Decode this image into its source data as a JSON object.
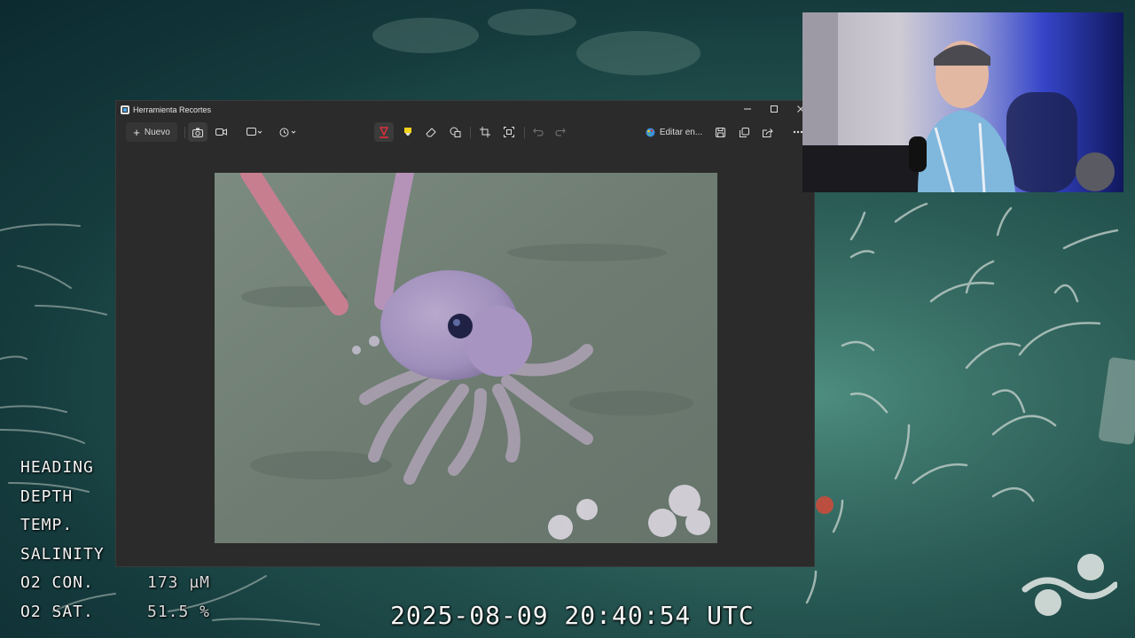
{
  "window": {
    "title": "Herramienta Recortes",
    "new_label": "Nuevo",
    "edit_label": "Editar en...",
    "controls": [
      "minimize-icon",
      "maximize-icon",
      "close-icon"
    ]
  },
  "toolbar": {
    "icons": [
      "camera-icon",
      "video-icon",
      "rectangle-mode-icon",
      "timer-icon",
      "pen-icon",
      "highlighter-icon",
      "eraser-icon",
      "shapes-icon",
      "crop-icon",
      "text-actions-icon",
      "undo-icon",
      "redo-icon",
      "paint-icon",
      "save-icon",
      "copy-icon",
      "share-icon",
      "more-icon"
    ],
    "accent_pen_color": "#e0303a",
    "highlighter_color": "#f2d21b"
  },
  "osd": {
    "rows": [
      {
        "label": "HEADING",
        "value": ""
      },
      {
        "label": "DEPTH",
        "value": ""
      },
      {
        "label": "TEMP.",
        "value": ""
      },
      {
        "label": "SALINITY",
        "value": ""
      },
      {
        "label": "O2 CON.",
        "value": "173 µM"
      },
      {
        "label": "O2 SAT.",
        "value": "51.5 %"
      }
    ],
    "timestamp": "2025-08-09 20:40:54 UTC"
  }
}
